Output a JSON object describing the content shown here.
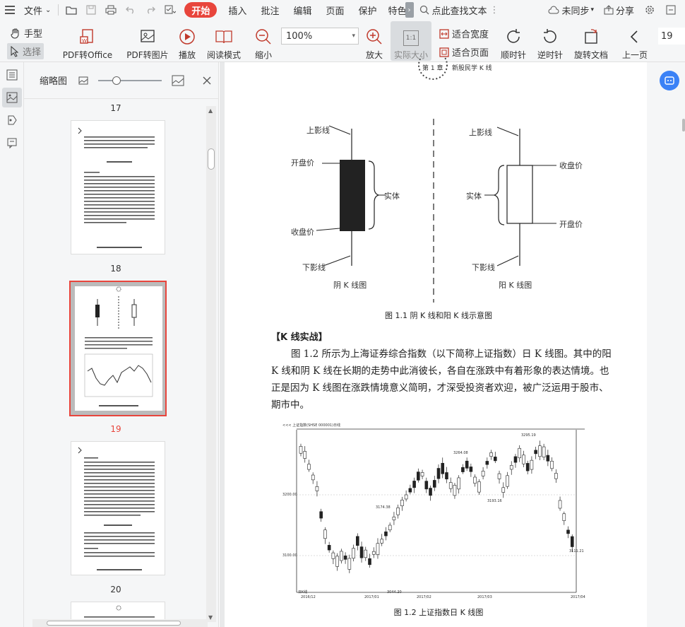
{
  "menubar": {
    "file_label": "文件",
    "tabs": [
      "开始",
      "插入",
      "批注",
      "编辑",
      "页面",
      "保护",
      "特色"
    ],
    "active_tab": "开始",
    "search_placeholder": "点此查找文本",
    "sync_label": "未同步",
    "share_label": "分享"
  },
  "toolbar": {
    "hand_label": "手型",
    "select_label": "选择",
    "pdf_to_office": "PDF转Office",
    "pdf_to_image": "PDF转图片",
    "play": "播放",
    "read_mode": "阅读模式",
    "zoom_out": "缩小",
    "zoom_value": "100%",
    "zoom_in": "放大",
    "actual_size": "实际大小",
    "actual_size_icon_text": "1:1",
    "fit_width": "适合宽度",
    "fit_page": "适合页面",
    "rotate_cw": "顺时针",
    "rotate_ccw": "逆时针",
    "rotate_doc": "旋转文档",
    "prev_page": "上一页",
    "page_number": "19"
  },
  "thumbnails": {
    "title": "缩略图",
    "pages": [
      {
        "label": "17",
        "current": false
      },
      {
        "label": "18",
        "current": false
      },
      {
        "label": "19",
        "current": true
      },
      {
        "label": "20",
        "current": false
      }
    ]
  },
  "document": {
    "chapter_mark": "第 1 章",
    "chapter_title": "新股民学 K 线",
    "diagram": {
      "left": {
        "upper_shadow": "上影线",
        "open_price": "开盘价",
        "body": "实体",
        "close_price": "收盘价",
        "lower_shadow": "下影线",
        "name": "阴 K 线图"
      },
      "right": {
        "upper_shadow": "上影线",
        "close_price": "收盘价",
        "body": "实体",
        "open_price": "开盘价",
        "lower_shadow": "下影线",
        "name": "阳 K 线图"
      },
      "caption": "图 1.1  阴 K 线和阳 K 线示意图"
    },
    "section_heading": "【K 线实战】",
    "paragraph_lines": [
      "图 1.2 所示为上海证券综合指数（以下简称上证指数）日 K 线图。其中的阳",
      "K 线和阴 K 线在长期的走势中此消彼长，各自在涨跌中有着形象的表达情境。也",
      "正是因为 K 线图在涨跌情境意义简明，才深受投资者欢迎，被广泛运用于股市、",
      "期市中。"
    ],
    "chart": {
      "header": "<<< 上证指数(SHSE 000001)日线",
      "price_labels": [
        "3295.19",
        "3264.08",
        "3174.38",
        "3193.16",
        "3111.21",
        "3044.20"
      ],
      "axis_labels": [
        "3200.00",
        "3100.00"
      ],
      "date_labels": [
        "2016/12",
        "2017/01",
        "2017/02",
        "2017/03",
        "2017/04"
      ],
      "period_label": "日K线",
      "caption": "图 1.2  上证指数日 K 线图"
    }
  }
}
